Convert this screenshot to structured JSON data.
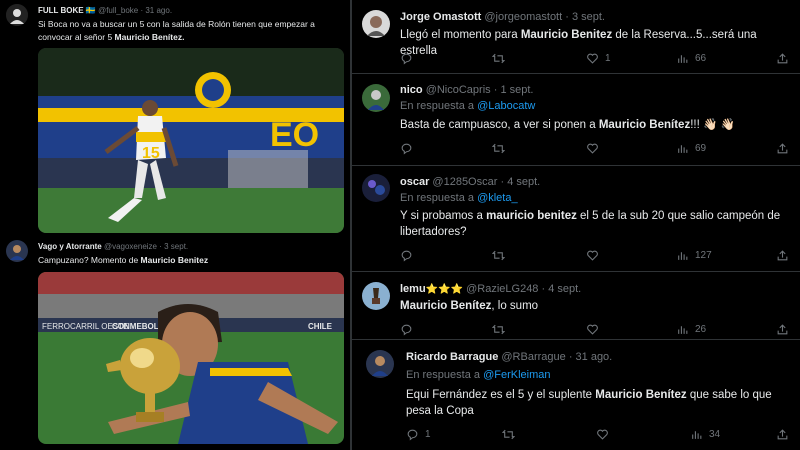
{
  "left_tweets": [
    {
      "name": "FULL BOKE",
      "flag": "🇸🇪",
      "handle": "@full_boke",
      "time": "· 31 ago.",
      "text_a": "Si Boca no va a buscar un 5 con la salida de Rolón tienen que empezar a convocar al señor 5 ",
      "text_b": "Mauricio Benítez."
    },
    {
      "name": "Vago y Atorrante",
      "handle": "@vagoxeneize",
      "time": "· 3 sept.",
      "text_a": "Campuzano? Momento de ",
      "text_b": "Mauricio Benitez"
    }
  ],
  "images": {
    "img1": {
      "banner_text": "EO",
      "jersey_number": "15"
    },
    "img2": {
      "board_left": "FERROCARRIL OESTE",
      "board_mid": "CONMEBOL",
      "board_right": "CHILE"
    }
  },
  "right_tweets": [
    {
      "name": "Jorge Omastott",
      "handle": "@jorgeomastott",
      "time": "· 3 sept.",
      "reply_prefix": "",
      "reply_to": "",
      "text_pre": "Llegó el momento para ",
      "text_bold": "Mauricio Benitez",
      "text_post": " de la Reserva...5...será una estrella",
      "retweets": "",
      "likes": "1",
      "views": "66"
    },
    {
      "name": "nico",
      "handle": "@NicoCapris",
      "time": "· 1 sept.",
      "reply_prefix": "En respuesta a ",
      "reply_to": "@Labocatw",
      "text_pre": "Basta de campuasco, a ver si ponen a ",
      "text_bold": "Mauricio Benítez",
      "text_post": "!!! 👋🏻 👋🏻",
      "retweets": "",
      "likes": "",
      "views": "69"
    },
    {
      "name": "oscar",
      "handle": "@1285Oscar",
      "time": "· 4 sept.",
      "reply_prefix": "En respuesta a ",
      "reply_to": "@kleta_",
      "text_pre": "Y si probamos a ",
      "text_bold": "mauricio benitez",
      "text_post": " el 5 de la sub 20 que salio campeón de libertadores?",
      "retweets": "",
      "likes": "",
      "views": "127"
    },
    {
      "name": "lemu",
      "stars": "⭐⭐⭐",
      "handle": "@RazieLG248",
      "time": "· 4 sept.",
      "reply_prefix": "",
      "reply_to": "",
      "text_pre": "",
      "text_bold": "Mauricio Benítez",
      "text_post": ", lo sumo",
      "retweets": "",
      "likes": "",
      "views": "26"
    },
    {
      "name": "Ricardo Barrague",
      "handle": "@RBarrague",
      "time": "· 31 ago.",
      "reply_prefix": "En respuesta a ",
      "reply_to": "@FerKleiman",
      "text_pre": "Equi Fernández es el 5 y el suplente ",
      "text_bold": "Mauricio Benítez",
      "text_post": " que sabe lo que pesa la Copa",
      "replies": "1",
      "retweets": "",
      "likes": "",
      "views": "34"
    }
  ],
  "icons": {
    "reply": "reply-icon",
    "retweet": "retweet-icon",
    "like": "heart-icon",
    "views": "views-icon",
    "share": "share-icon"
  },
  "colors": {
    "link": "#1d9bf0",
    "muted": "#71767b",
    "text": "#e7e9ea",
    "boca_blue": "#1f3f8a",
    "boca_gold": "#f2c200"
  }
}
